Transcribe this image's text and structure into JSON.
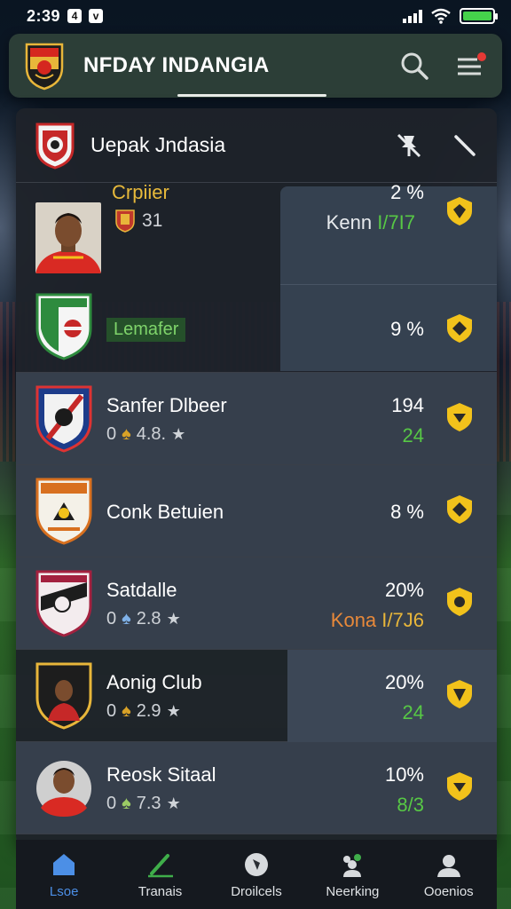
{
  "status_bar": {
    "time": "2:39",
    "mini_glyph_1": "4",
    "mini_glyph_2": "v"
  },
  "header": {
    "title": "NFDAY INDANGIA",
    "icons": [
      "club-logo-icon",
      "search-icon",
      "menu-icon"
    ],
    "has_notification_dot": true
  },
  "league": {
    "title": "Uepak Jndasia",
    "actions": [
      "pin-off-icon",
      "edit-pencil-icon"
    ]
  },
  "featured": {
    "player_name": "Crpiier",
    "player_number": "31",
    "percent_top": "2 %",
    "line_text": "Kenn",
    "line_value": "I/7I7",
    "club_label": "Lemafer",
    "percent_bottom": "9 %"
  },
  "rows": [
    {
      "name": "Sanfer Dlbeer",
      "meta_a": "0",
      "meta_b": "4.8.",
      "stat": "194",
      "stat2": "24",
      "stat2_color": "#57c845"
    },
    {
      "name": "Conk Betuien",
      "stat": "8 %"
    },
    {
      "name": "Satdalle",
      "meta_a": "0",
      "meta_b": "2.8",
      "stat": "20%",
      "stat2_label": "Kona",
      "stat2": "I/7J6"
    },
    {
      "name": "Aonig Club",
      "meta_a": "0",
      "meta_b": "2.9",
      "stat": "20%",
      "stat2": "24"
    },
    {
      "name": "Reosk Sitaal",
      "meta_a": "0",
      "meta_b": "7.3",
      "stat": "10%",
      "stat2": "8/3"
    }
  ],
  "nav": [
    {
      "label": "Lsoe",
      "icon": "home-icon",
      "active": true
    },
    {
      "label": "Tranais",
      "icon": "pitch-edit-icon",
      "active": false
    },
    {
      "label": "Droilcels",
      "icon": "ball-icon",
      "active": false
    },
    {
      "label": "Neerking",
      "icon": "team-icon",
      "active": false
    },
    {
      "label": "Ooenios",
      "icon": "profile-icon",
      "active": false
    }
  ],
  "colors": {
    "accent_yellow": "#f2c21b",
    "accent_green": "#57c845",
    "accent_orange": "#e8893a",
    "nav_active": "#4c8fe6"
  }
}
